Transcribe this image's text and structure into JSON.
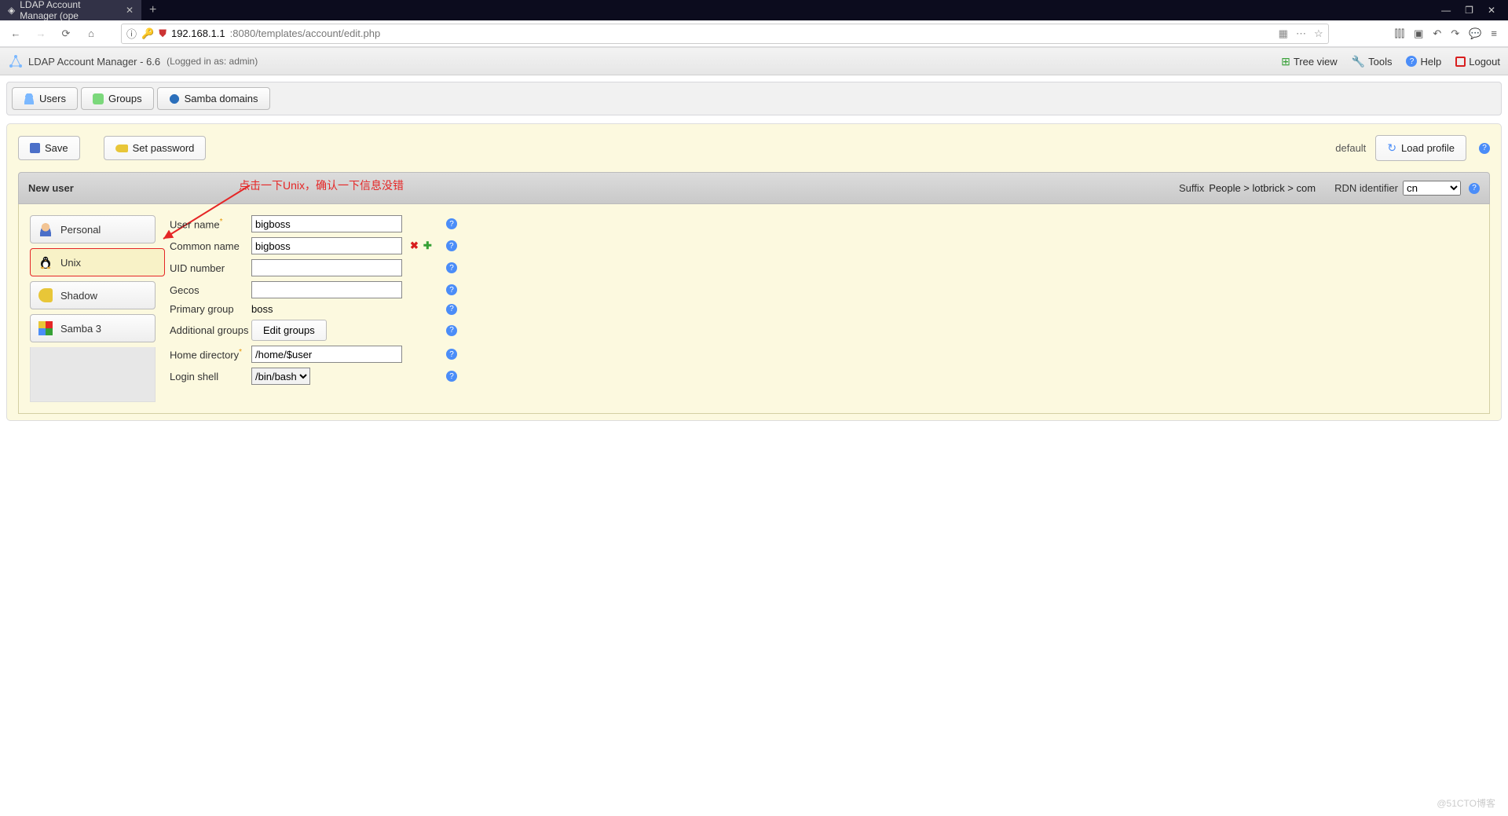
{
  "browser": {
    "tab_title": "LDAP Account Manager (ope",
    "url_prefix": "192.168.1.1",
    "url_rest": ":8080/templates/account/edit.php",
    "win_min": "—",
    "win_max": "❐",
    "win_close": "✕"
  },
  "header": {
    "title": "LDAP Account Manager - 6.6",
    "logged_in": "(Logged in as: admin)",
    "links": {
      "tree": "Tree view",
      "tools": "Tools",
      "help": "Help",
      "logout": "Logout"
    }
  },
  "top_tabs": {
    "users": "Users",
    "groups": "Groups",
    "samba": "Samba domains"
  },
  "actions": {
    "save": "Save",
    "set_password": "Set password",
    "default_label": "default",
    "load_profile": "Load profile"
  },
  "section": {
    "title": "New user",
    "annotation": "点击一下Unix，确认一下信息没错",
    "suffix_label": "Suffix",
    "suffix_path": "People > lotbrick > com",
    "rdn_label": "RDN identifier",
    "rdn_value": "cn"
  },
  "modules": {
    "personal": "Personal",
    "unix": "Unix",
    "shadow": "Shadow",
    "samba3": "Samba 3"
  },
  "form": {
    "user_name": {
      "label": "User name",
      "value": "bigboss"
    },
    "common_name": {
      "label": "Common name",
      "value": "bigboss"
    },
    "uid_number": {
      "label": "UID number",
      "value": ""
    },
    "gecos": {
      "label": "Gecos",
      "value": ""
    },
    "primary_group": {
      "label": "Primary group",
      "value": "boss"
    },
    "additional_groups": {
      "label": "Additional groups",
      "button": "Edit groups"
    },
    "home_dir": {
      "label": "Home directory",
      "value": "/home/$user"
    },
    "login_shell": {
      "label": "Login shell",
      "value": "/bin/bash"
    }
  },
  "watermark": "@51CTO博客"
}
